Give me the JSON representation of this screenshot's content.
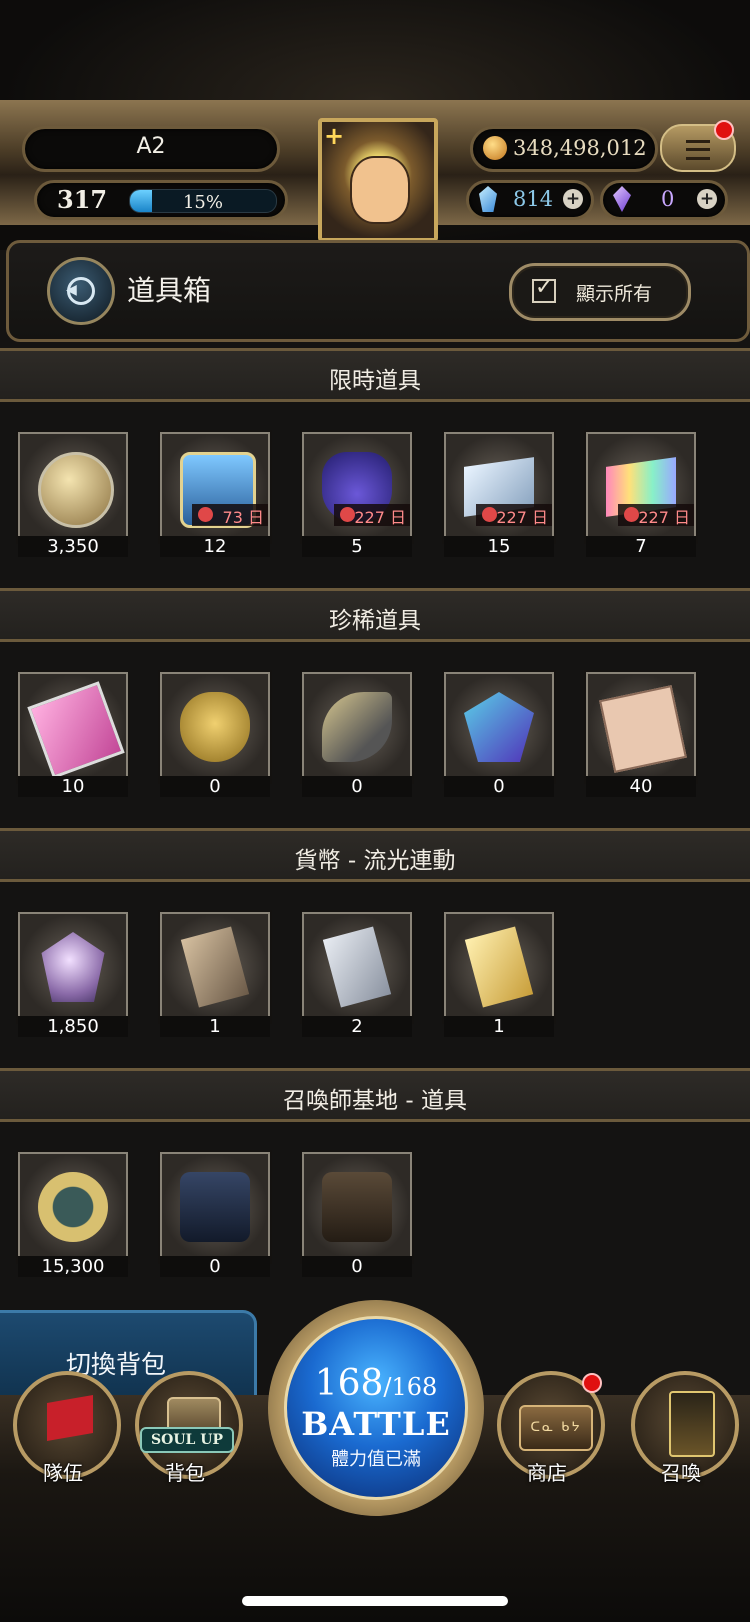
{
  "header": {
    "player_name": "A2",
    "level": "317",
    "exp_percent": 15,
    "exp_label": "15%",
    "gold": "348,498,012",
    "gems": "814",
    "crystals": "0"
  },
  "page": {
    "title": "道具箱",
    "show_all_label": "顯示所有"
  },
  "sections": [
    {
      "title": "限時道具",
      "items": [
        {
          "icon": "coin-medal-icon",
          "count": "3,350"
        },
        {
          "icon": "treasure-chest-icon",
          "count": "12",
          "timer": "73 日"
        },
        {
          "icon": "item-bag-icon",
          "count": "5",
          "timer": "227 日"
        },
        {
          "icon": "silver-ticket-icon",
          "count": "15",
          "timer": "227 日"
        },
        {
          "icon": "rainbow-ticket-icon",
          "count": "7",
          "timer": "227 日"
        }
      ]
    },
    {
      "title": "珍稀道具",
      "items": [
        {
          "icon": "pink-card-icon",
          "count": "10"
        },
        {
          "icon": "golden-heart-icon",
          "count": "0"
        },
        {
          "icon": "horn-icon",
          "count": "0"
        },
        {
          "icon": "crystal-icon",
          "count": "0"
        },
        {
          "icon": "magic-scroll-icon",
          "count": "40"
        }
      ]
    },
    {
      "title": "貨幣 - 流光連動",
      "items": [
        {
          "icon": "prism-gem-icon",
          "count": "1,850"
        },
        {
          "icon": "bronze-card-icon",
          "count": "1"
        },
        {
          "icon": "silver-card-icon",
          "count": "2"
        },
        {
          "icon": "gold-card-icon",
          "count": "1"
        }
      ]
    },
    {
      "title": "召喚師基地 - 道具",
      "items": [
        {
          "icon": "base-medal-icon",
          "count": "15,300"
        },
        {
          "icon": "blue-pack-icon",
          "count": "0"
        },
        {
          "icon": "brown-pack-icon",
          "count": "0"
        }
      ]
    }
  ],
  "switch_bag_label": "切換背包",
  "nav": {
    "team": "隊伍",
    "bag": "背包",
    "soul_up": "SOUL UP",
    "shop": "商店",
    "shop_sign": "ᑕᓇ ᑲᔭ",
    "summon": "召喚"
  },
  "battle": {
    "stamina_current": "168",
    "stamina_max": "/168",
    "label": "BATTLE",
    "status": "體力值已滿"
  }
}
